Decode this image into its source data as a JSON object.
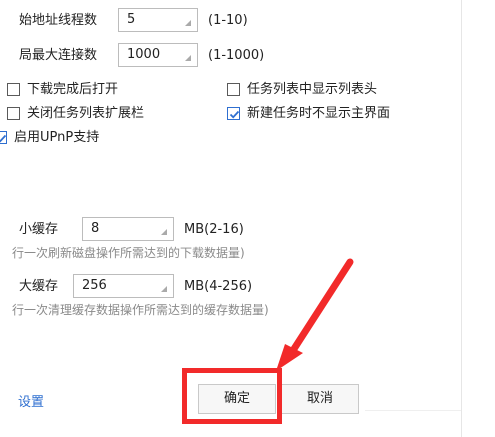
{
  "settings": {
    "thread_count": {
      "label": "始地址线程数",
      "value": "5",
      "range": "(1-10)"
    },
    "max_connections": {
      "label": "局最大连接数",
      "value": "1000",
      "range": "(1-1000)"
    },
    "checkboxes": {
      "open_after_download": {
        "label": "下载完成后打开",
        "checked": false
      },
      "show_list_header": {
        "label": "任务列表中显示列表头",
        "checked": false
      },
      "close_list_extension": {
        "label": "关闭任务列表扩展栏",
        "checked": false
      },
      "no_main_on_new_task": {
        "label": "新建任务时不显示主界面",
        "checked": true
      },
      "enable_upnp": {
        "label": "启用UPnP支持",
        "checked": true
      }
    },
    "min_cache": {
      "label": "小缓存",
      "value": "8",
      "range": "MB(2-16)",
      "hint": "行一次刷新磁盘操作所需达到的下载数据量)"
    },
    "max_cache": {
      "label": "大缓存",
      "value": "256",
      "range": "MB(4-256)",
      "hint": "行一次清理缓存数据操作所需达到的缓存数据量)"
    }
  },
  "footer": {
    "settings_link": "设置",
    "confirm_label": "确定",
    "cancel_label": "取消"
  },
  "colors": {
    "annotation_red": "#f22a2a",
    "link_blue": "#2f6fd0",
    "check_blue": "#2f6fd0"
  }
}
